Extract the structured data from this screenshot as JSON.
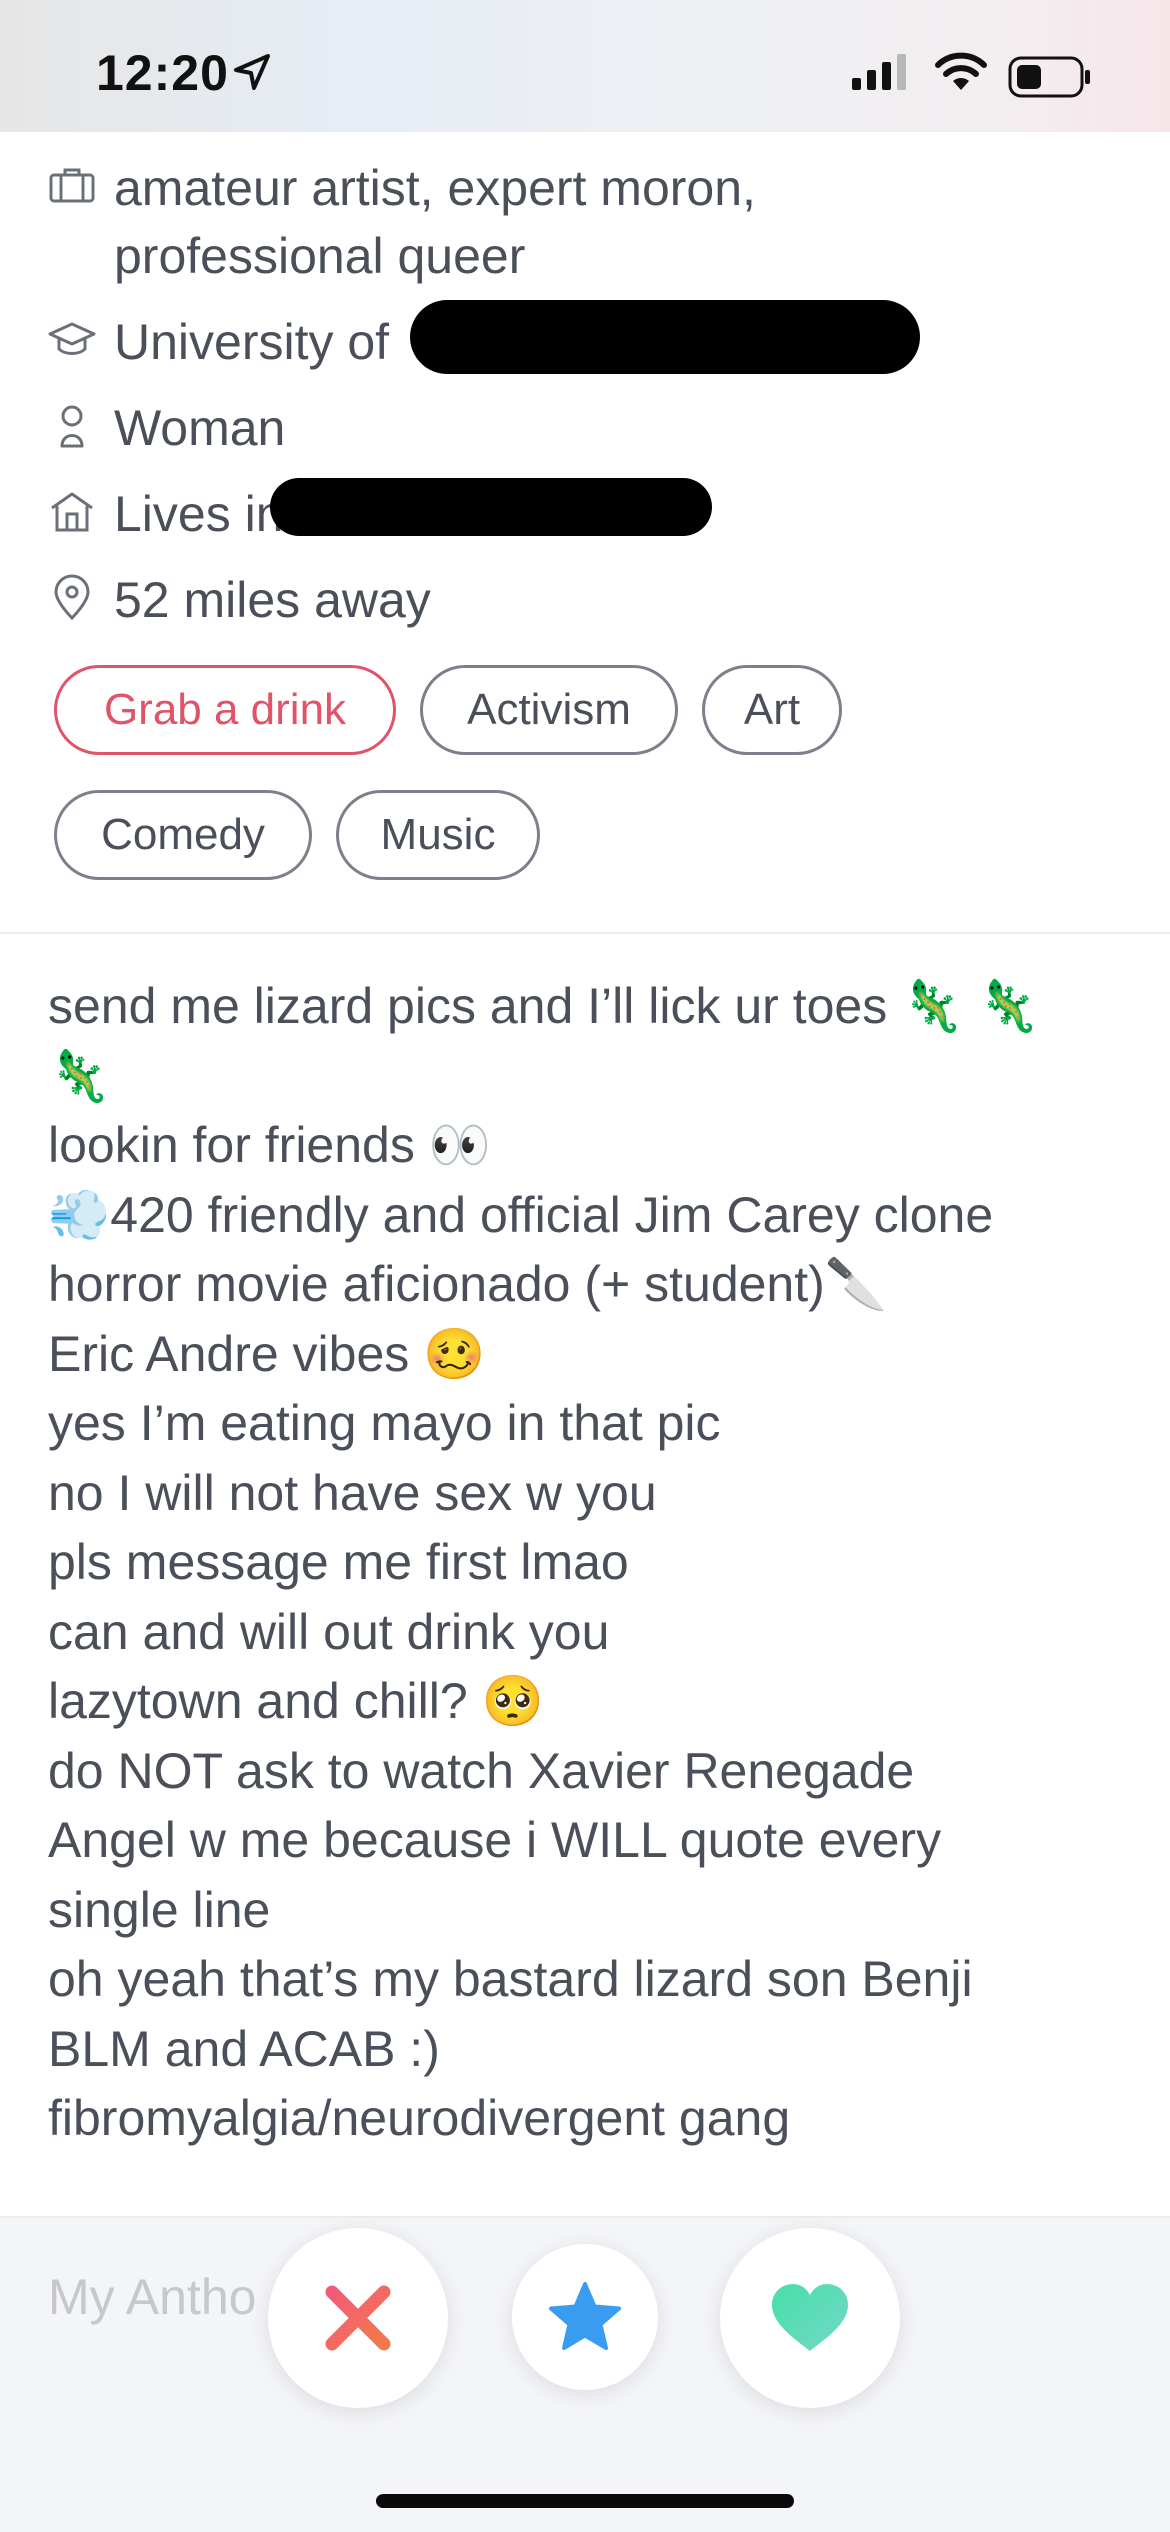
{
  "status_bar": {
    "time": "12:20"
  },
  "profile_info": {
    "job": "amateur artist, expert moron,",
    "job_line2": "professional queer",
    "school": "University of",
    "gender": "Woman",
    "lives": "Lives in",
    "distance": "52 miles away"
  },
  "interests": [
    "Grab a drink",
    "Activism",
    "Art",
    "Comedy",
    "Music"
  ],
  "bio": [
    "send me lizard pics and I’ll lick ur toes",
    "lookin for friends",
    "420 friendly and official Jim Carey clone",
    "horror movie aficionado (+ student)",
    "Eric Andre vibes",
    "yes I’m eating mayo in that pic",
    "no I will not have sex w you",
    "pls message me first lmao",
    "can and will out drink you",
    "lazytown and chill?",
    "do NOT ask to watch Xavier Renegade",
    "Angel w me because i WILL quote every",
    "single line",
    "oh yeah that’s my bastard lizard son Benji",
    "BLM and ACAB :)",
    "fibromyalgia/neurodivergent gang"
  ],
  "next_section": "My Antho",
  "colors": {
    "accent_pink": "#e0546a",
    "nope_red": "#f0625e",
    "star_blue": "#3a9cf0",
    "like_green": "#5edcb6"
  },
  "icons": {
    "job": "briefcase-icon",
    "school": "graduation-cap-icon",
    "gender": "person-icon",
    "lives": "house-icon",
    "distance": "location-pin-icon",
    "nope": "x-icon",
    "super_like": "star-icon",
    "like": "heart-icon"
  }
}
